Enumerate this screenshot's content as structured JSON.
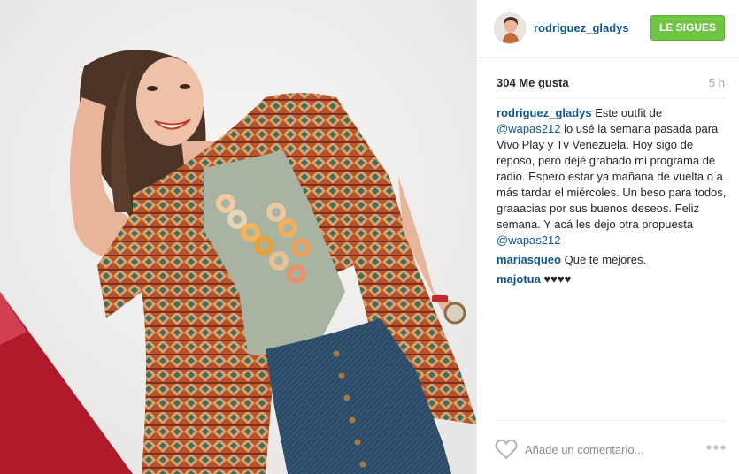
{
  "photo": {
    "alt_icon": "post-photo"
  },
  "header": {
    "username": "rodriguez_gladys",
    "follow_label": "LE SIGUES",
    "follow_color": "#6fc543"
  },
  "stats": {
    "likes": "304 Me gusta",
    "time": "5 h"
  },
  "caption": {
    "user": "rodriguez_gladys",
    "text_1": " Este outfit de ",
    "mention_1": "@wapas212",
    "text_2": " lo usé la semana pasada para Vivo Play y Tv Venezuela. Hoy sigo de reposo, pero dejé grabado mi programa de radio. Espero estar ya mañana de vuelta o a más tardar el miércoles. Un beso para todos, graaacias por sus buenos deseos. Feliz semana. Y acá les dejo otra propuesta ",
    "mention_2": "@wapas212"
  },
  "comments": [
    {
      "user": "mariasqueo",
      "text": " Que te mejores."
    },
    {
      "user": "majotua",
      "text": " ♥♥♥♥"
    }
  ],
  "add_comment": {
    "placeholder": "Añade un comentario..."
  },
  "colors": {
    "link_blue": "#125688",
    "muted_gray": "#a5a7aa"
  }
}
